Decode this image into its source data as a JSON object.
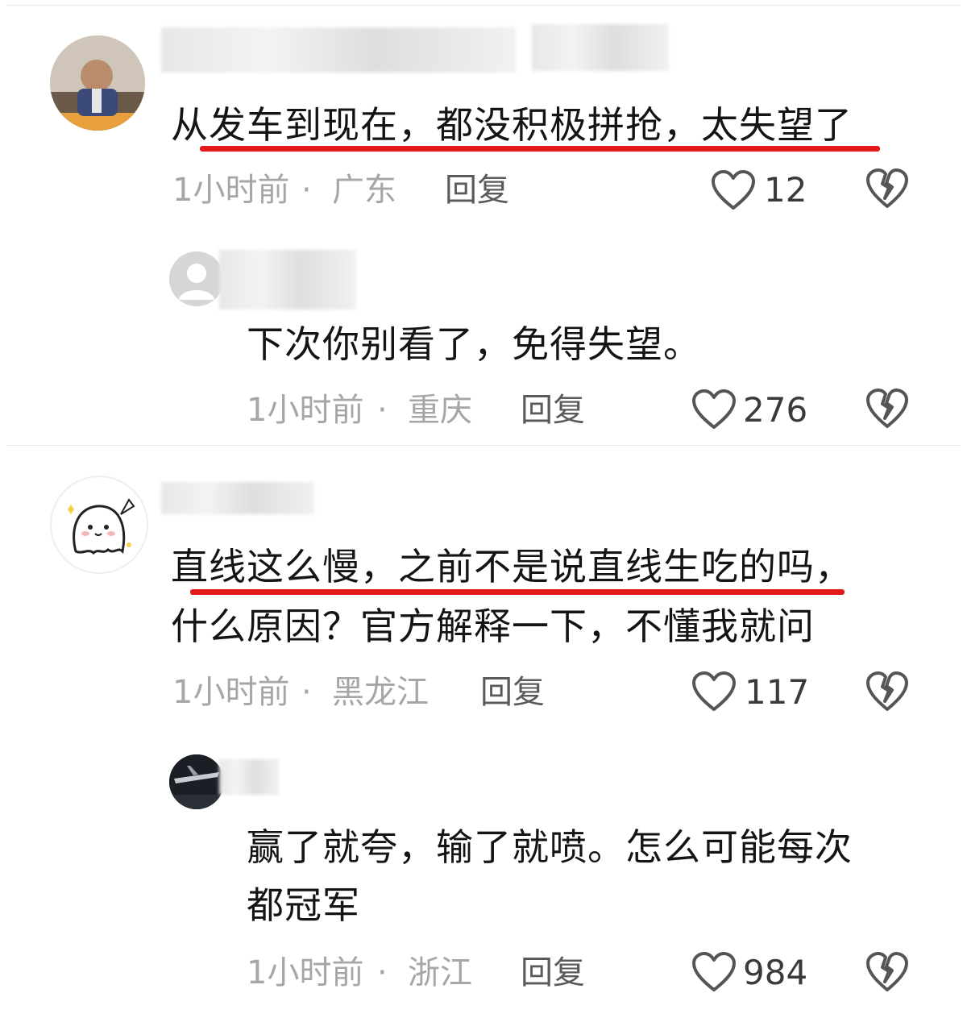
{
  "comments": [
    {
      "text_lines": [
        "从发车到现在，都没积极拼抢，太失望了"
      ],
      "time": "1小时前",
      "region": "广东",
      "reply_label": "回复",
      "likes": "12"
    },
    {
      "text_lines": [
        "下次你别看了，免得失望。"
      ],
      "time": "1小时前",
      "region": "重庆",
      "reply_label": "回复",
      "likes": "276"
    },
    {
      "text_lines": [
        "直线这么慢，之前不是说直线生吃的吗，",
        "什么原因？官方解释一下，不懂我就问"
      ],
      "time": "1小时前",
      "region": "黑龙江",
      "reply_label": "回复",
      "likes": "117"
    },
    {
      "text_lines": [
        "赢了就夸，输了就喷。怎么可能每次",
        "都冠军"
      ],
      "time": "1小时前",
      "region": "浙江",
      "reply_label": "回复",
      "likes": "984"
    }
  ],
  "meta_separator": "·",
  "colors": {
    "underline": "#e11a1a",
    "meta": "#a6a6a6",
    "text": "#141414"
  }
}
